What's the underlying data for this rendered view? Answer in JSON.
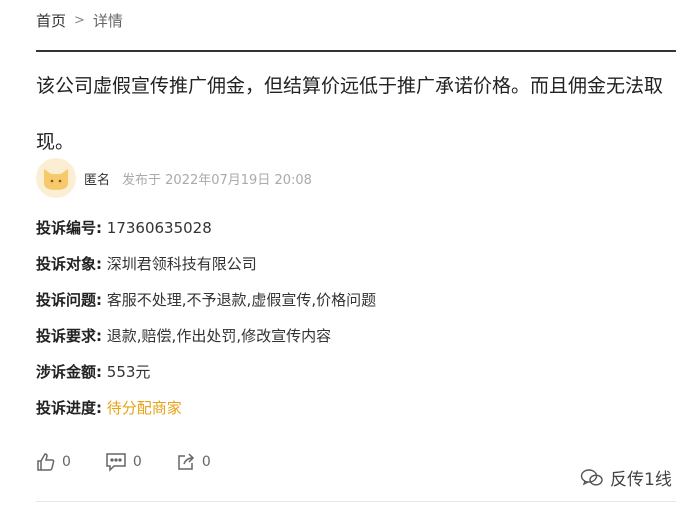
{
  "breadcrumb": {
    "home": "首页",
    "separator": ">",
    "current": "详情"
  },
  "complaint": {
    "text": "该公司虚假宣传推广佣金，但结算价远低于推广承诺价格。而且佣金无法取现。"
  },
  "author": {
    "name": "匿名",
    "posted": "发布于 2022年07月19日 20:08",
    "avatar_icon": "cat-avatar-icon"
  },
  "fields": [
    {
      "label": "投诉编号:",
      "value": "17360635028"
    },
    {
      "label": "投诉对象:",
      "value": "深圳君领科技有限公司"
    },
    {
      "label": "投诉问题:",
      "value": "客服不处理,不予退款,虚假宣传,价格问题"
    },
    {
      "label": "投诉要求:",
      "value": "退款,赔偿,作出处罚,修改宣传内容"
    },
    {
      "label": "涉诉金额:",
      "value": "553元"
    },
    {
      "label": "投诉进度:",
      "value": "待分配商家"
    }
  ],
  "actions": {
    "like_count": "0",
    "comment_count": "0",
    "share_count": "0"
  },
  "watermark": {
    "text": "反传1线"
  },
  "colors": {
    "progress": "#e8a317",
    "avatar_bg": "#fbeed3",
    "avatar_cat": "#f6c96b"
  }
}
